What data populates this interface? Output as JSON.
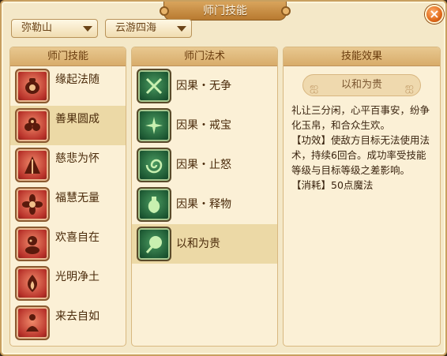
{
  "window": {
    "title": "师门技能",
    "close_glyph": "×"
  },
  "filters": {
    "school": "弥勒山",
    "region": "云游四海"
  },
  "left_panel": {
    "header": "师门技能",
    "items": [
      {
        "label": "缘起法随",
        "icon": "pot-icon"
      },
      {
        "label": "善果圆成",
        "icon": "fruit-basket-icon"
      },
      {
        "label": "慈悲为怀",
        "icon": "robe-icon"
      },
      {
        "label": "福慧无量",
        "icon": "lotus-icon"
      },
      {
        "label": "欢喜自在",
        "icon": "monk-icon"
      },
      {
        "label": "光明净土",
        "icon": "flame-icon"
      },
      {
        "label": "来去自如",
        "icon": "seated-figure-icon"
      }
    ],
    "selected_index": 1
  },
  "middle_panel": {
    "header": "师门法术",
    "items": [
      {
        "label": "因果・无争",
        "icon": "crossed-blades-icon"
      },
      {
        "label": "因果・戒宝",
        "icon": "spark-burst-icon"
      },
      {
        "label": "因果・止怒",
        "icon": "vortex-icon"
      },
      {
        "label": "因果・释物",
        "icon": "vase-icon"
      },
      {
        "label": "以和为贵",
        "icon": "fan-icon"
      }
    ],
    "selected_index": 4
  },
  "right_panel": {
    "header": "技能效果",
    "skill_name": "以和为贵",
    "description": "礼让三分闲，心平百事安，纷争化玉帛，和合众生欢。",
    "effect": "【功效】使敌方目标无法使用法术，持续6回合。成功率受技能等级与目标等级之差影响。",
    "cost": "【消耗】50点魔法"
  },
  "colors": {
    "accent": "#b87a30",
    "selected_row": "#ecd9a6",
    "panel_bg": "#fbf0d6",
    "close": "#e06a1a"
  }
}
